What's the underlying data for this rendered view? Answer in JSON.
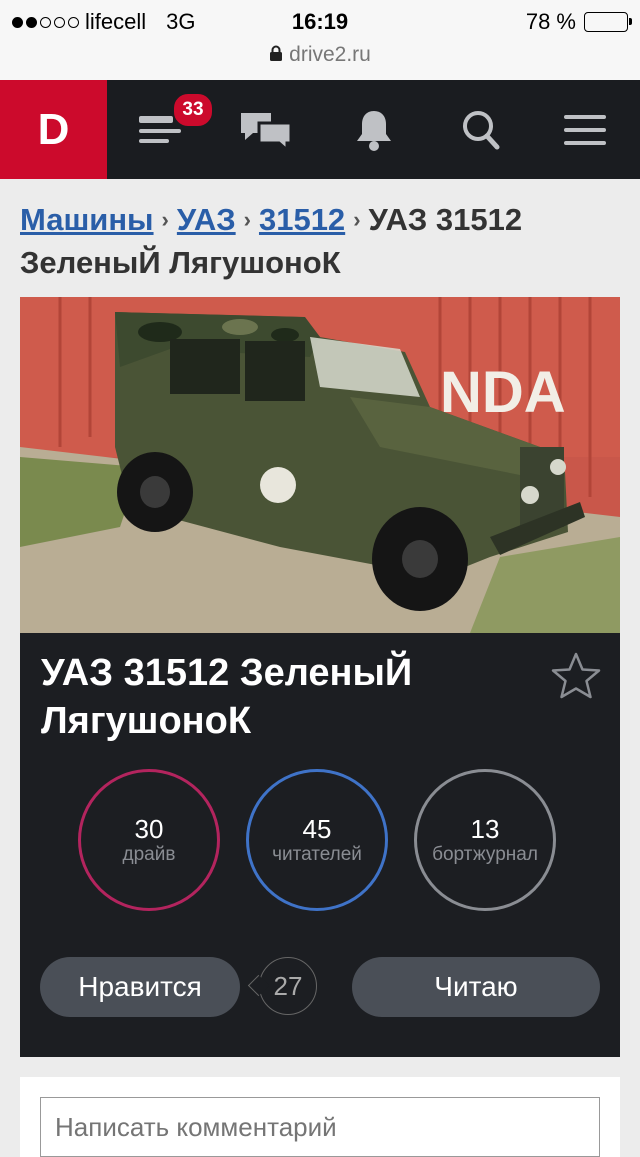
{
  "status": {
    "carrier": "lifecell",
    "network": "3G",
    "time": "16:19",
    "battery": "78 %",
    "battery_level": 0.78,
    "url": "drive2.ru"
  },
  "nav": {
    "logo": "D",
    "feed_badge": "33",
    "icons": [
      "feed-icon",
      "messages-icon",
      "bell-icon",
      "search-icon",
      "menu-icon"
    ]
  },
  "breadcrumb": {
    "items": [
      "Машины",
      "УАЗ",
      "31512"
    ],
    "current": "УАЗ 31512 ЗеленыЙ ЛягушоноК",
    "separator": "›"
  },
  "car": {
    "title": "УАЗ 31512 ЗеленыЙ ЛягушоноК",
    "stats": [
      {
        "value": "30",
        "label": "драйв",
        "color": "#b3245e"
      },
      {
        "value": "45",
        "label": "читателей",
        "color": "#3f73c8"
      },
      {
        "value": "13",
        "label": "бортжурнал",
        "color": "#8a8d93"
      }
    ],
    "like_label": "Нравится",
    "like_count": "27",
    "follow_label": "Читаю"
  },
  "comment": {
    "placeholder": "Написать комментарий"
  },
  "colors": {
    "brand": "#cc0a2c",
    "nav_bg": "#1a1c20",
    "link": "#2a5ea8",
    "card_bg": "#1c1e22"
  }
}
